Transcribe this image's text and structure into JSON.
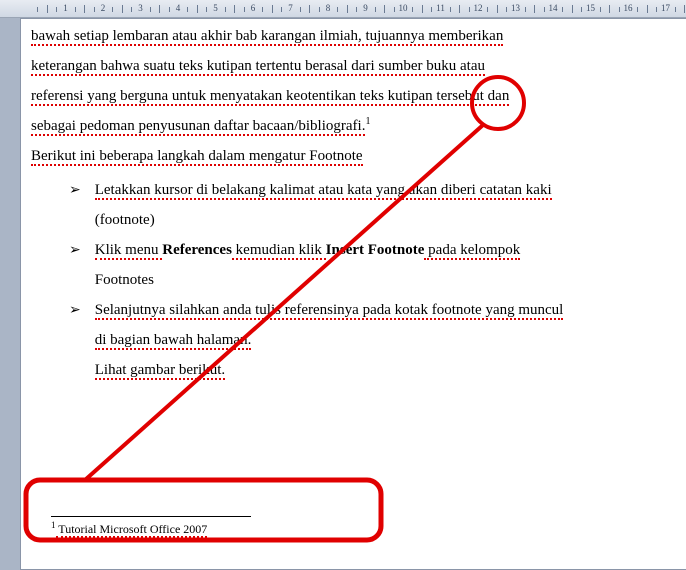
{
  "ruler": {
    "start": 0,
    "end": 17,
    "unit": "cm"
  },
  "document": {
    "paragraph1_parts": {
      "p1": "bawah setiap lembaran atau akhir bab karangan ilmiah, tujuannya memberikan",
      "p2": "keterangan bahwa suatu teks kutipan tertentu berasal dari sumber buku atau",
      "p3": "referensi yang berguna untuk menyatakan keotentikan teks kutipan tersebut dan",
      "p4_pre": "sebagai pedoman penyusunan daftar bacaan/bibliografi.",
      "p4_sup": "1"
    },
    "paragraph2": "Berikut ini beberapa langkah dalam mengatur Footnote",
    "bullets": [
      {
        "line1": "Letakkan kursor di belakang kalimat atau kata yang akan diberi catatan kaki",
        "line2": "(footnote)"
      },
      {
        "line1_parts": {
          "a": "Klik menu ",
          "b_bold": "References",
          "c": " kemudian klik ",
          "d_bold": "Insert Footnote",
          "e": " pada kelompok"
        },
        "line2": "Footnotes"
      },
      {
        "line1": "Selanjutnya silahkan anda tulis referensinya pada kotak footnote yang muncul",
        "line2": "di bagian bawah halaman.",
        "line3": "Lihat gambar berikut."
      }
    ],
    "footnote": {
      "number": "1",
      "text": " Tutorial Microsoft Office 2007"
    }
  },
  "spellcheck_words": [
    "bawah",
    "setiap",
    "lembaran",
    "atau",
    "akhir",
    "karangan",
    "ilmiah",
    "tujuannya",
    "memberikan",
    "keterangan",
    "bahwa",
    "suatu",
    "teks",
    "kutipan",
    "tertentu",
    "berasal",
    "dari",
    "sumber",
    "buku",
    "referensi",
    "berguna",
    "untuk",
    "menyatakan",
    "keotentikan",
    "tersebut",
    "sebagai",
    "pedoman",
    "penyusunan",
    "daftar",
    "bacaan",
    "bibliografi",
    "Berikut",
    "ini",
    "beberapa",
    "langkah",
    "dalam",
    "mengatur",
    "Letakkan",
    "kursor",
    "belakang",
    "kalimat",
    "kata",
    "akan",
    "diberi",
    "catatan",
    "kaki",
    "Klik",
    "kemudian",
    "klik",
    "pada",
    "kelompok",
    "Selanjutnya",
    "silahkan",
    "anda",
    "tulis",
    "referensinya",
    "kotak",
    "muncul",
    "bagian",
    "halaman",
    "Lihat",
    "gambar",
    "berikut"
  ]
}
